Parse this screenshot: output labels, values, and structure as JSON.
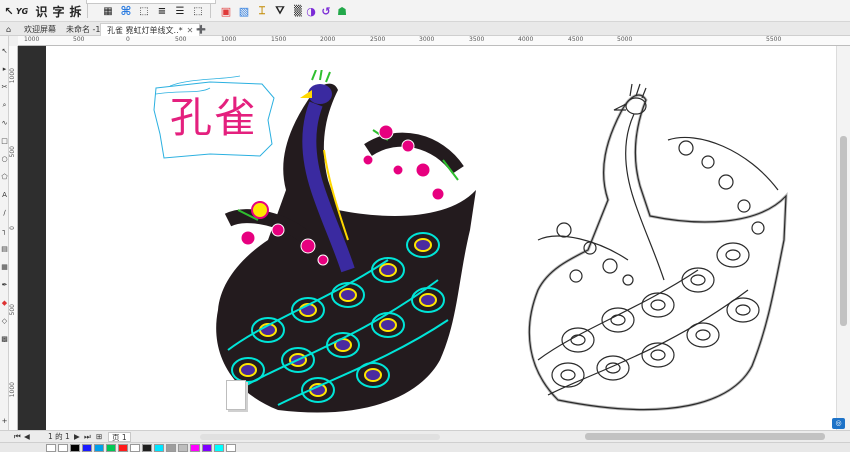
{
  "toolbar": {
    "text_tools": [
      "识",
      "字",
      "拆"
    ],
    "icons": [
      "pick-icon",
      "curve-text-icon",
      "grid-icon",
      "node-icon",
      "select-all-icon",
      "align-icon",
      "shape-icon",
      "color-icon",
      "text-frame-icon",
      "fill-icon",
      "weld-icon",
      "plugin-icon"
    ]
  },
  "tabs": [
    {
      "label": "欢迎屏幕"
    },
    {
      "label": "未命名 -1"
    },
    {
      "label": "孔雀 霓虹灯单线文..*"
    }
  ],
  "ruler": {
    "h_labels": [
      "1000",
      "500",
      "0",
      "500",
      "1000",
      "1500",
      "2000",
      "2500",
      "3000",
      "3500",
      "4000",
      "4500",
      "5000",
      "5500"
    ],
    "v_labels": [
      "1000",
      "500",
      "0",
      "500",
      "1000"
    ]
  },
  "artwork": {
    "title_text": "孔雀",
    "title_color": "#e4207e",
    "neon_colors": [
      "#00e5d8",
      "#ffe600",
      "#e7007f",
      "#2fbf2f",
      "#4b2aa0"
    ]
  },
  "pagebar": {
    "page_of": "1 的 1",
    "page_label": "页 1"
  },
  "palette": {
    "swatches": [
      "#ffffff",
      "#000000",
      "#1a1aff",
      "#00a0e9",
      "#00c853",
      "#ff1a1a",
      "#ffffff",
      "#1f1f1f",
      "#00e5ff",
      "#9e9e9e",
      "#bdbdbd",
      "#ff00ff",
      "#7e00ff",
      "#00ffff",
      "#ffffff"
    ]
  }
}
